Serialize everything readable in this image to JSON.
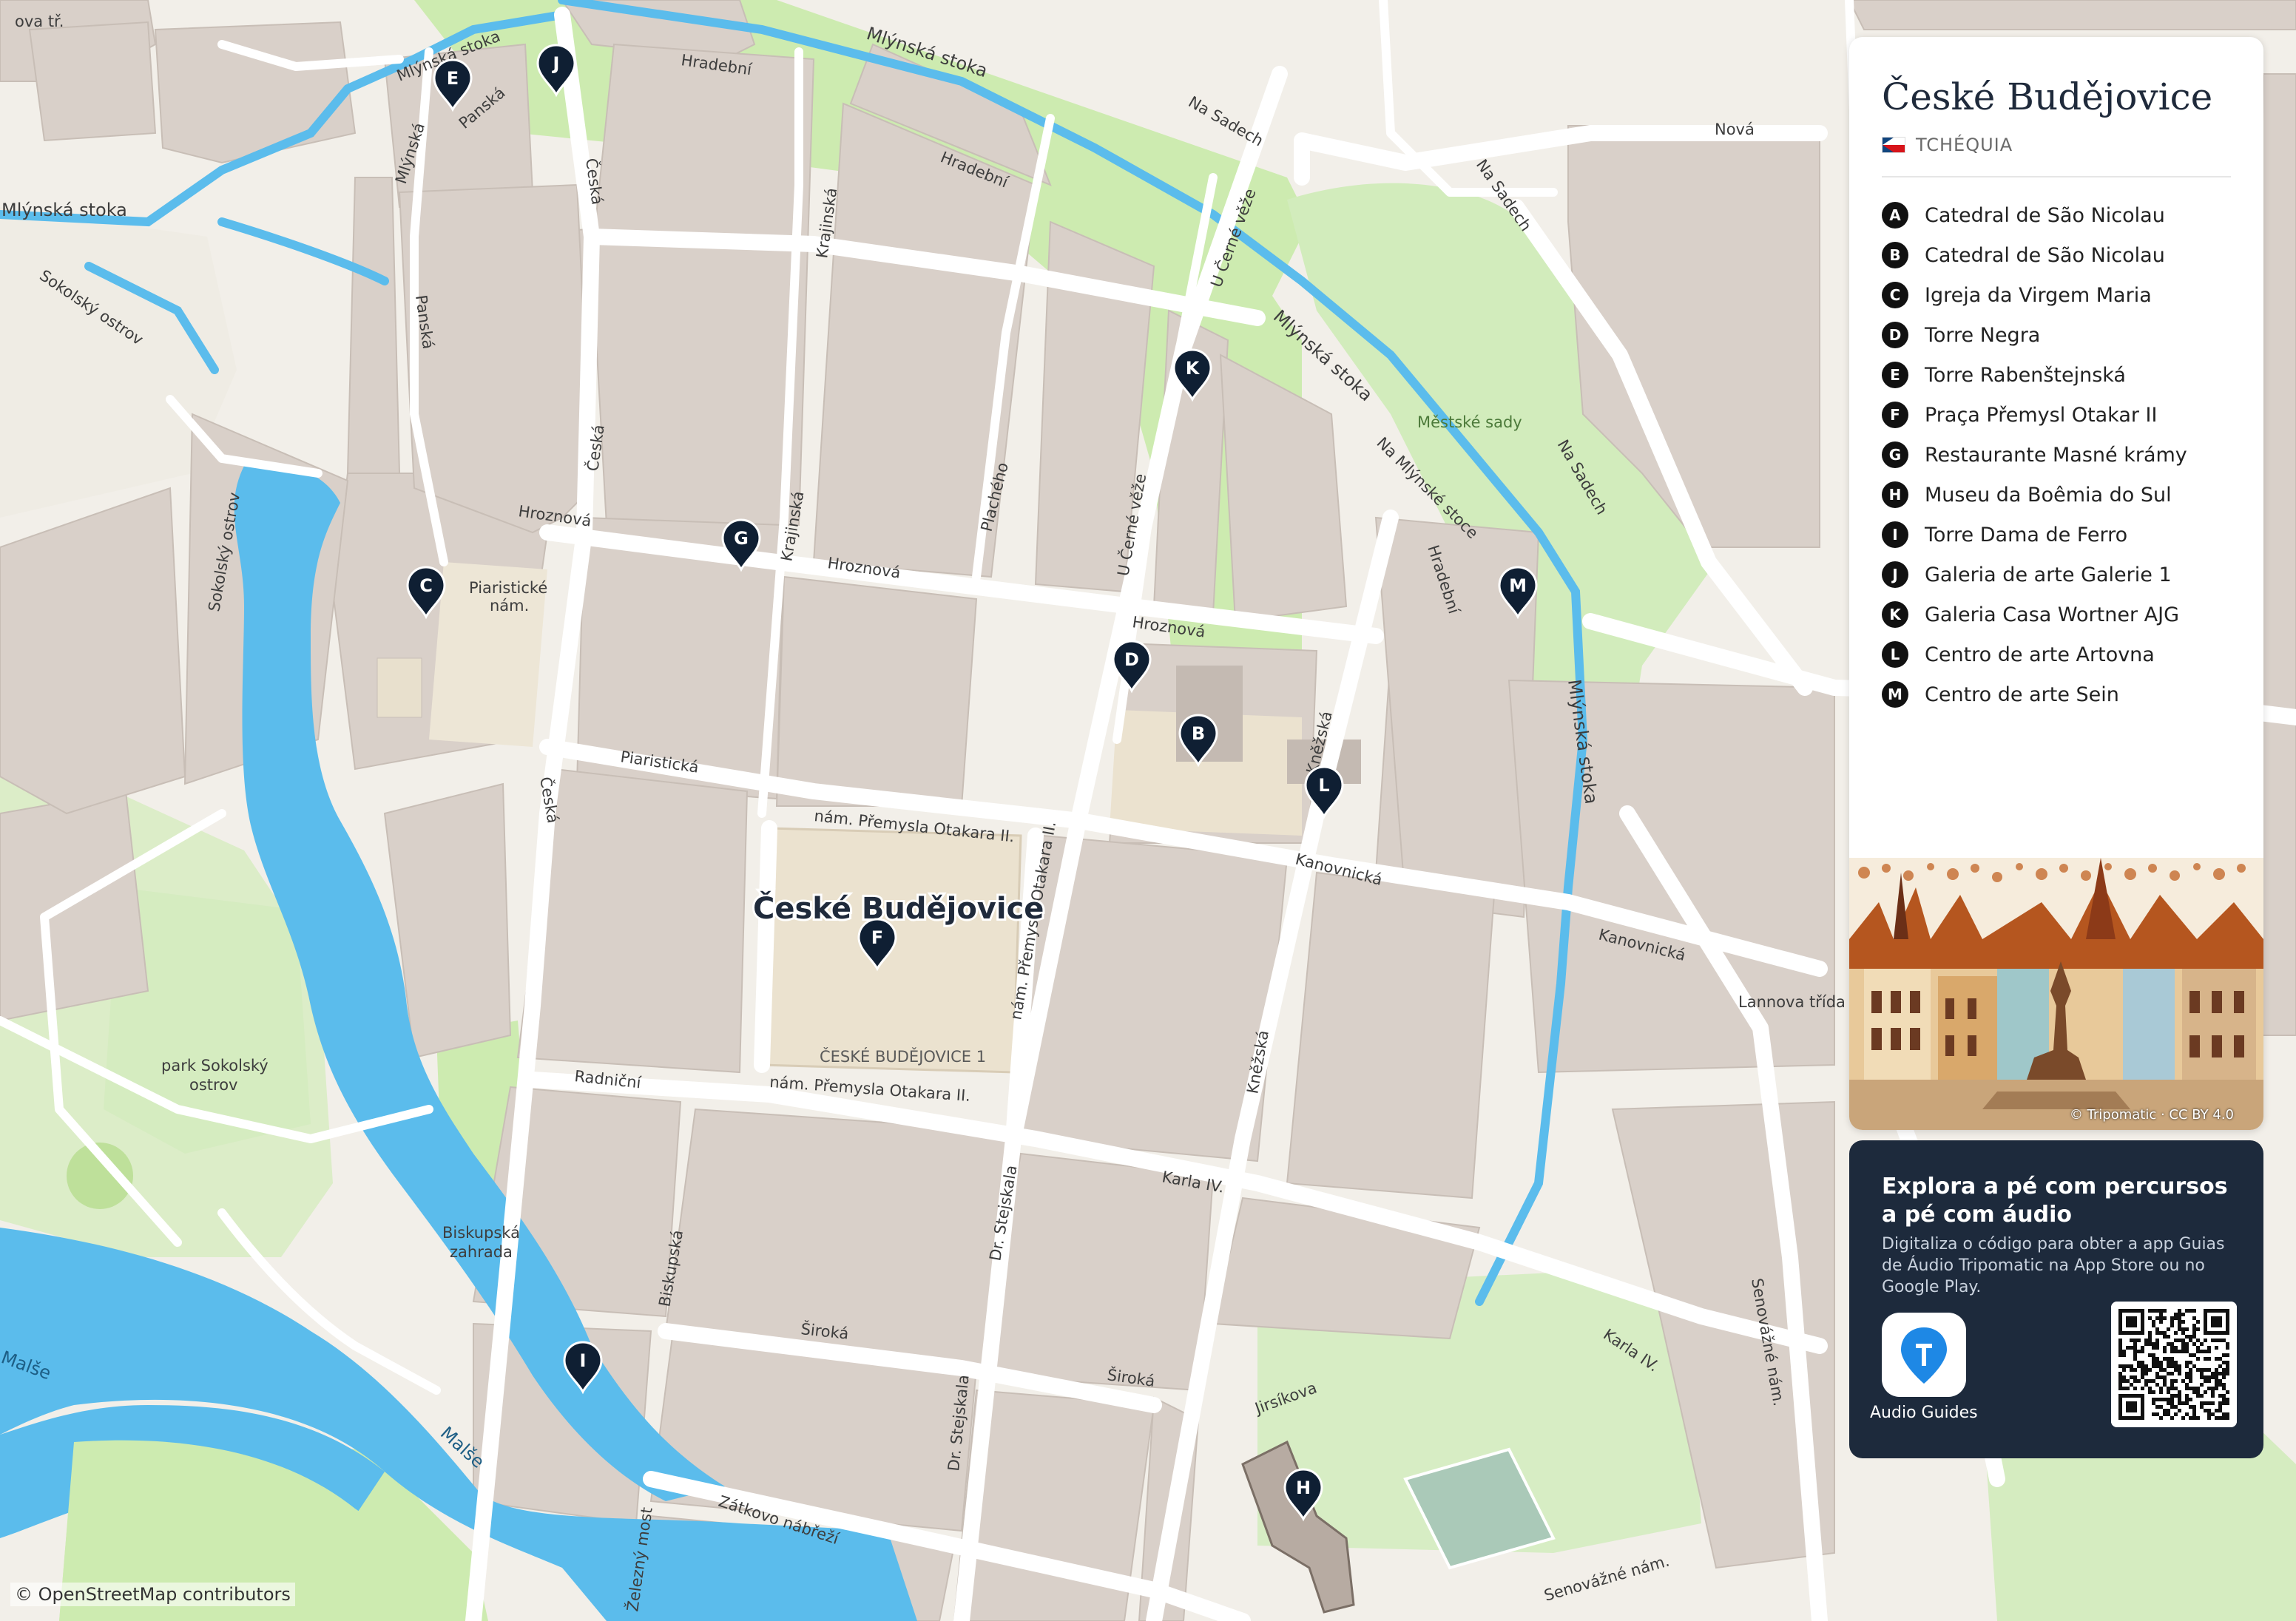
{
  "panel": {
    "title": "České Budějovice",
    "country": "TCHÉQUIA",
    "legend": [
      {
        "key": "A",
        "name": "Catedral de São Nicolau"
      },
      {
        "key": "B",
        "name": "Catedral de São Nicolau"
      },
      {
        "key": "C",
        "name": "Igreja da Virgem Maria"
      },
      {
        "key": "D",
        "name": "Torre Negra"
      },
      {
        "key": "E",
        "name": "Torre Rabenštejnská"
      },
      {
        "key": "F",
        "name": "Praça Přemysl Otakar II"
      },
      {
        "key": "G",
        "name": "Restaurante Masné krámy"
      },
      {
        "key": "H",
        "name": "Museu da Boêmia do Sul"
      },
      {
        "key": "I",
        "name": "Torre Dama de Ferro"
      },
      {
        "key": "J",
        "name": "Galeria de arte Galerie 1"
      },
      {
        "key": "K",
        "name": "Galeria Casa Wortner AJG"
      },
      {
        "key": "L",
        "name": "Centro de arte Artovna"
      },
      {
        "key": "M",
        "name": "Centro de arte Sein"
      }
    ],
    "art_credit": "© Tripomatic · CC BY 4.0"
  },
  "promo": {
    "heading": "Explora a pé com percursos a pé com áudio",
    "description": "Digitaliza o código para obter a app Guias de Áudio Tripomatic na App Store ou no Google Play.",
    "app_label": "Audio Guides"
  },
  "map": {
    "city_label": "České Budějovice",
    "attribution": "© OpenStreetMap contributors",
    "colors": {
      "land": "#f2efe9",
      "block": "#d9d0c9",
      "water": "#5bbcec",
      "green": "#cdebb0",
      "road": "#ffffff",
      "marker": "#0f1f33"
    },
    "labels": {
      "mlynska_1": "Mlýnská stoka",
      "mlynska_2": "Mlýnská stoka",
      "mlynska_3": "Mlýnská stoka",
      "mlynska_4": "Mlýnská stoka",
      "mlynska_5": "Mlýnská stoka",
      "mlynska_str": "Mlýnská",
      "panska_1": "Panská",
      "panska_2": "Panská",
      "hradebni_1": "Hradební",
      "hradebni_2": "Hradební",
      "hradebni_3": "Hradební",
      "na_sadech_1": "Na Sadech",
      "na_sadech_2": "Na Sadech",
      "na_sadech_3": "Na Sadech",
      "nova": "Nová",
      "u_cerne_veze_1": "U Černé věže",
      "u_cerne_veze_2": "U Černé věže",
      "ceska_1": "Česká",
      "ceska_2": "Česká",
      "ceska_3": "Česká",
      "krajinska_1": "Krajinská",
      "krajinska_2": "Krajinská",
      "plachy": "Plachého",
      "hroznova_1": "Hroznová",
      "hroznova_2": "Hroznová",
      "hroznova_3": "Hroznová",
      "mestske_sady": "Městské sady",
      "na_mlynske_stoce": "Na Mlýnské stoce",
      "sokolsky_1": "Sokolský ostrov",
      "sokolsky_2": "Sokolský ostrov",
      "piaristicke_1": "Piaristické",
      "piaristicke_2": "nám.",
      "piaristicka": "Piaristická",
      "nam_po_1": "nám. Přemysla Otakara II.",
      "nam_po_2": "nám. Přemysla Otakara II.",
      "nam_po_3": "nám. Přemysla Otakara II.",
      "cb1": "ČESKÉ BUDĚJOVICE 1",
      "kanovnicka_1": "Kanovnická",
      "kanovnicka_2": "Kanovnická",
      "knezska_1": "Kněžská",
      "knezska_2": "Kněžská",
      "lannova": "Lannova třída",
      "radnicni": "Radniční",
      "park_1": "park Sokolský",
      "park_2": "ostrov",
      "biskupska_z1": "Biskupská",
      "biskupska_z2": "zahrada",
      "biskupska": "Biskupská",
      "stejskala_1": "Dr. Stejskala",
      "stejskala_2": "Dr. Stejskala",
      "karla_1": "Karla IV.",
      "karla_2": "Karla IV.",
      "siroka_1": "Široká",
      "siroka_2": "Široká",
      "senovazne_1": "Senovážné nám.",
      "senovazne_2": "Senovážné nám.",
      "jirsikova": "Jirsíkova",
      "malse_1": "Malše",
      "malse_2": "Malše",
      "zatkovo": "Zátkovo nábřeží",
      "zelezny": "Železný most",
      "trida": "ova tř."
    }
  }
}
